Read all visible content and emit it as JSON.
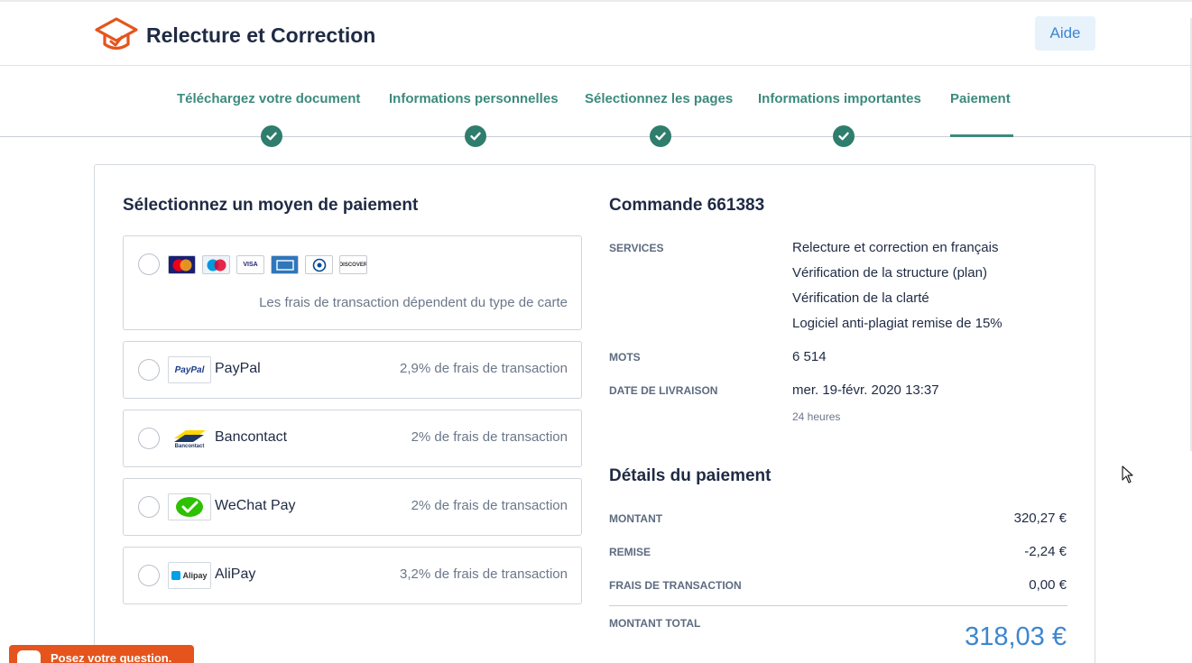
{
  "header": {
    "title": "Relecture et Correction",
    "help_label": "Aide",
    "brand_color": "#e5541d"
  },
  "steps": [
    {
      "label": "Téléchargez votre document",
      "done": true
    },
    {
      "label": "Informations personnelles",
      "done": true
    },
    {
      "label": "Sélectionnez les pages",
      "done": true
    },
    {
      "label": "Informations importantes",
      "done": true
    },
    {
      "label": "Paiement",
      "active": true
    }
  ],
  "payment": {
    "title": "Sélectionnez un moyen de paiement",
    "card_option": {
      "cards": [
        "MasterCard",
        "Maestro",
        "VISA",
        "AMEX",
        "Diners Club",
        "DISCOVER"
      ],
      "note": "Les frais de transaction dépendent du type de carte"
    },
    "options": [
      {
        "name": "PayPal",
        "fee": "2,9% de frais de transaction",
        "logo": "PayPal"
      },
      {
        "name": "Bancontact",
        "fee": "2% de frais de transaction",
        "logo": "Bancontact"
      },
      {
        "name": "WeChat Pay",
        "fee": "2% de frais de transaction",
        "logo": ""
      },
      {
        "name": "AliPay",
        "fee": "3,2% de frais de transaction",
        "logo": "Alipay"
      }
    ]
  },
  "order": {
    "title": "Commande 661383",
    "services_label": "SERVICES",
    "services": [
      "Relecture et correction en français",
      "Vérification de la structure (plan)",
      "Vérification de la clarté",
      "Logiciel anti-plagiat remise de 15%"
    ],
    "words_label": "MOTS",
    "words": "6 514",
    "delivery_label": "DATE DE LIVRAISON",
    "delivery_date": "mer. 19-févr. 2020 13:37",
    "delivery_speed": "24 heures"
  },
  "details": {
    "title": "Détails du paiement",
    "amount_label": "MONTANT",
    "amount": "320,27 €",
    "discount_label": "REMISE",
    "discount": "-2,24 €",
    "fee_label": "FRAIS DE TRANSACTION",
    "fee": "0,00 €",
    "total_label": "MONTANT TOTAL",
    "total": "318,03 €"
  },
  "chat": {
    "label": "Posez votre question."
  }
}
